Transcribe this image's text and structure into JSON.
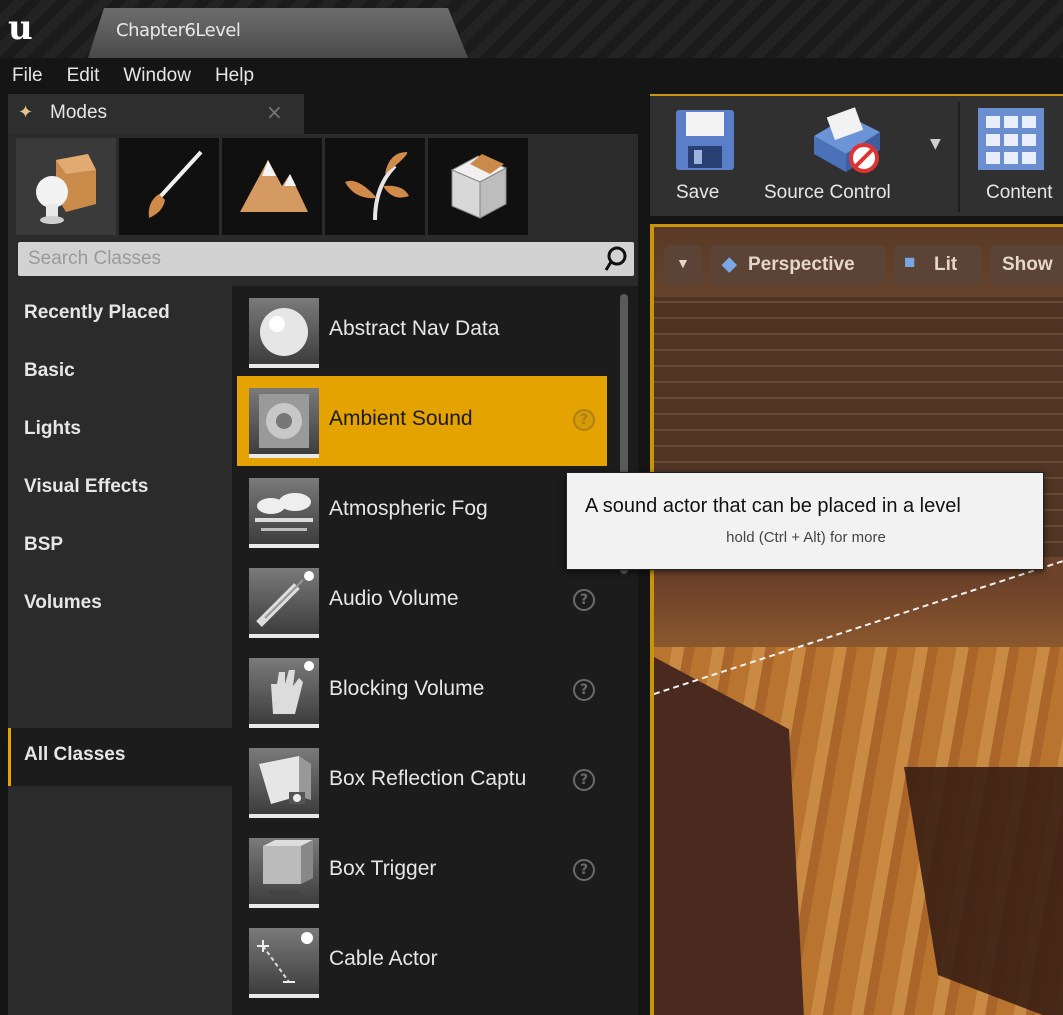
{
  "window": {
    "title": "Chapter6Level",
    "logo": "unreal-logo"
  },
  "menu": [
    "File",
    "Edit",
    "Window",
    "Help"
  ],
  "modes_panel": {
    "title": "Modes",
    "close_glyph": "×",
    "mode_icons": [
      "place-mode-icon",
      "paint-mode-icon",
      "landscape-mode-icon",
      "foliage-mode-icon",
      "geometry-edit-mode-icon"
    ],
    "search_placeholder": "Search Classes",
    "categories": [
      "Recently Placed",
      "Basic",
      "Lights",
      "Visual Effects",
      "BSP",
      "Volumes",
      "All Classes"
    ],
    "active_category": "All Classes",
    "classes": [
      {
        "label": "Abstract Nav Data",
        "help": false
      },
      {
        "label": "Ambient Sound",
        "help": true,
        "selected": true
      },
      {
        "label": "Atmospheric Fog",
        "help": false
      },
      {
        "label": "Audio Volume",
        "help": true
      },
      {
        "label": "Blocking Volume",
        "help": true
      },
      {
        "label": "Box Reflection Captu",
        "help": true
      },
      {
        "label": "Box Trigger",
        "help": true
      },
      {
        "label": "Cable Actor",
        "help": false
      }
    ]
  },
  "toolbar": {
    "save_label": "Save",
    "source_control_label": "Source Control",
    "content_label": "Content"
  },
  "viewport": {
    "perspective_label": "Perspective",
    "lit_label": "Lit",
    "show_label": "Show"
  },
  "tooltip": {
    "text": "A sound actor that can be placed in a level",
    "hint": "hold (Ctrl + Alt) for more"
  },
  "colors": {
    "accent": "#e4a300",
    "panel": "#2b2b2b",
    "list_bg": "#1c1c1c"
  }
}
